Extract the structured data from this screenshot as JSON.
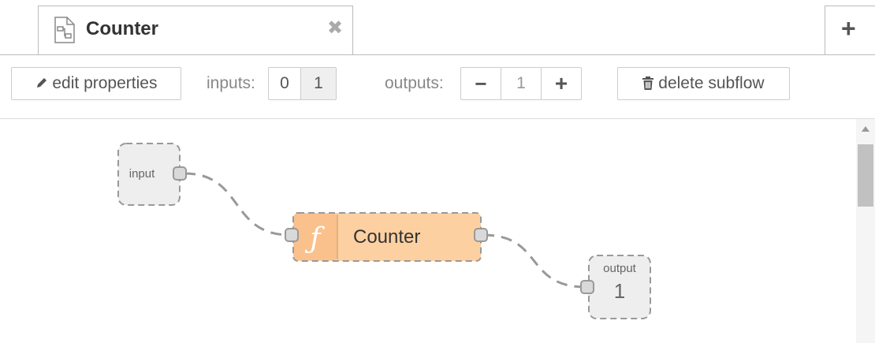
{
  "tab": {
    "label": "Counter",
    "close_glyph": "✖",
    "icon": "subflow-icon"
  },
  "add_tab_glyph": "+",
  "toolbar": {
    "edit_properties_label": "edit properties",
    "inputs_label": "inputs:",
    "inputs_options": [
      "0",
      "1"
    ],
    "outputs_label": "outputs:",
    "outputs_minus": "−",
    "outputs_value": "1",
    "outputs_plus": "+",
    "delete_subflow_label": "delete subflow"
  },
  "flow": {
    "input_node": {
      "label": "input"
    },
    "function_node": {
      "label": "Counter",
      "icon_glyph": "ƒ",
      "color": "#fdd0a2"
    },
    "output_node": {
      "label": "output",
      "number": "1"
    }
  },
  "colors": {
    "border": "#bbbbbb",
    "function_fill": "#fdd0a2",
    "port_fill": "#d9d9d9",
    "wire": "#999999"
  }
}
